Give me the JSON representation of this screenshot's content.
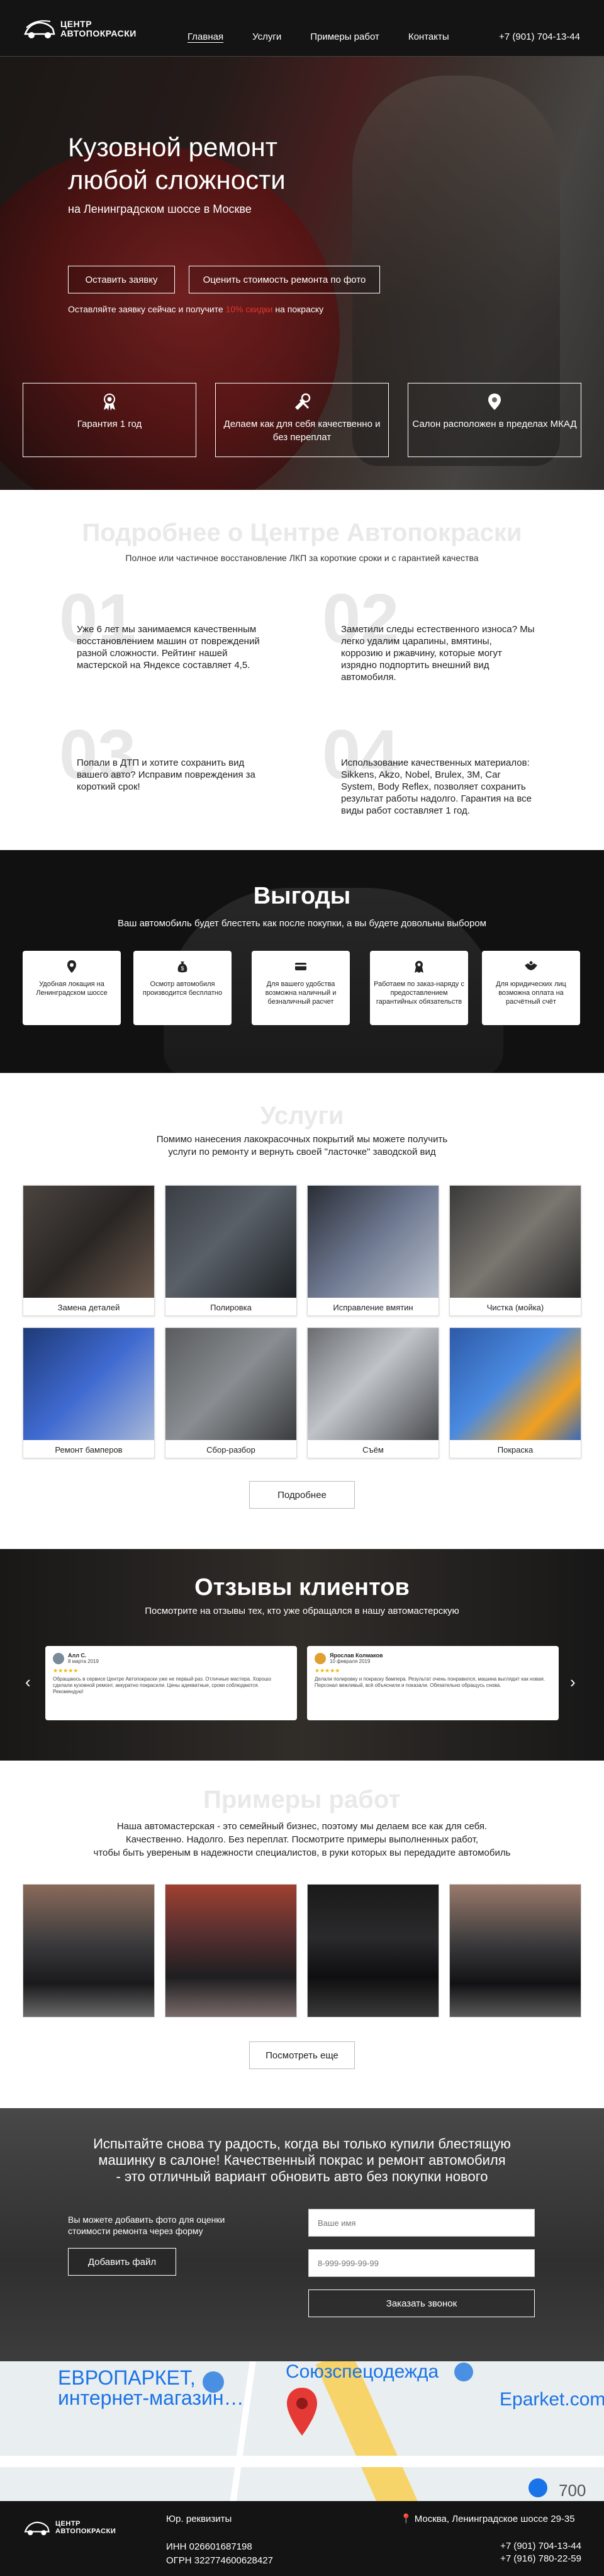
{
  "header": {
    "logo_text_line1": "ЦЕНТР",
    "logo_text_line2": "АВТОПОКРАСКИ",
    "nav": [
      "Главная",
      "Услуги",
      "Примеры работ",
      "Контакты"
    ],
    "phone": "+7 (901) 704-13-44"
  },
  "hero": {
    "title": "Кузовной ремонт любой сложности",
    "subtitle": "на Ленинградском шоссе в Москве",
    "btn_request": "Оставить заявку",
    "btn_estimate": "Оценить стоимость ремонта по фото",
    "note_prefix": "Оставляйте заявку сейчас и получите",
    "note_highlight": "10% скидки",
    "note_suffix": "на покраску",
    "features": [
      {
        "icon": "award-icon",
        "text": "Гарантия 1 год"
      },
      {
        "icon": "tools-icon",
        "text": "Делаем как для себя качественно и без переплат"
      },
      {
        "icon": "location-pin-icon",
        "text": "Салон расположен в пределах МКАД"
      }
    ]
  },
  "about": {
    "title": "Подробнее о Центре Автопокраски",
    "lead": "Полное или частичное восстановление ЛКП за короткие сроки и с гарантией качества",
    "items": [
      {
        "num": "01",
        "text": "Уже 6 лет мы занимаемся качественным восстановлением машин от повреждений разной сложности. Рейтинг нашей мастерской на Яндексе составляет 4,5."
      },
      {
        "num": "02",
        "text": "Заметили следы естественного износа? Мы легко удалим царапины, вмятины, коррозию и ржавчину, которые могут изрядно подпортить внешний вид автомобиля."
      },
      {
        "num": "03",
        "text": "Попали в ДТП и хотите сохранить вид вашего авто? Исправим повреждения за короткий срок!"
      },
      {
        "num": "04",
        "text": "Использование качественных материалов: Sikkens, Akzo, Nobel, Brulex, 3M, Car System, Body Reflex, позволяет сохранить результат работы надолго. Гарантия на все виды работ составляет 1 год."
      }
    ]
  },
  "benefits": {
    "title": "Выгоды",
    "lead": "Ваш автомобиль будет блестеть как после покупки, а вы будете довольны выбором",
    "cards": [
      {
        "icon": "location-pin-icon",
        "text": "Удобная локация на Ленинградском шоссе"
      },
      {
        "icon": "money-bag-icon",
        "text": "Осмотр автомобиля производится бесплатно"
      },
      {
        "icon": "card-icon",
        "text": "Для вашего удобства возможна наличный и безналичный расчет"
      },
      {
        "icon": "award-icon",
        "text": "Работаем по заказ-наряду с предоставлением гарантийных обязательств"
      },
      {
        "icon": "handshake-icon",
        "text": "Для юридических лиц возможна оплата на расчётный счёт"
      }
    ]
  },
  "services": {
    "title": "Услуги",
    "lead_line1": "Помимо нанесения лакокрасочных покрытий мы можете получить",
    "lead_line2": "услуги по ремонту и вернуть своей \"ласточке\" заводской вид",
    "items": [
      "Замена деталей",
      "Полировка",
      "Исправление вмятин",
      "Чистка (мойка)",
      "Ремонт бамперов",
      "Сбор-разбор",
      "Съём",
      "Покраска"
    ],
    "more_label": "Подробнее"
  },
  "reviews": {
    "title": "Отзывы клиентов",
    "lead": "Посмотрите на отзывы тех, кто уже обращался в нашу автомастерскую",
    "items": [
      {
        "name": "Алл С.",
        "date": "8 марта 2019",
        "text": "Обращаюсь в сервисе Центре Автопокраски уже не первый раз. Отличные мастера. Хорошо сделали кузовной ремонт, аккуратно покрасили. Цены адекватные, сроки соблюдаются. Рекомендую!"
      },
      {
        "name": "Ярослав Колмаков",
        "date": "10 февраля 2019",
        "text": "Делали полировку и покраску бампера. Результат очень понравился, машина выглядит как новая. Персонал вежливый, всё объяснили и показали. Обязательно обращусь снова."
      }
    ]
  },
  "works": {
    "title": "Примеры работ",
    "lead_line1": "Наша автомастерская - это семейный бизнес, поэтому мы делаем все как для себя.",
    "lead_line2": "Качественно. Надолго. Без переплат. Посмотрите примеры выполненных работ,",
    "lead_line3": "чтобы быть увереным в надежности специалистов, в руки которых вы передадите автомобиль",
    "more_label": "Посмотреть еще"
  },
  "cta": {
    "title_line1": "Испытайте снова ту радость, когда вы только купили блестящую",
    "title_line2": "машинку в салоне! Качественный покрас и ремонт автомобиля",
    "title_line3": "- это отличный вариант обновить авто без покупки нового",
    "left_text": "Вы можете добавить фото для оценки стоимости ремонта через форму",
    "file_label": "Добавить файл",
    "name_placeholder": "Ваше имя",
    "phone_placeholder": "8-999-999-99-99",
    "call_label": "Заказать звонок"
  },
  "map": {
    "label1_line1": "ЕВРОПАРКЕТ,",
    "label1_line2": "интернет-магазин…",
    "label2": "Союзспецодежда",
    "label3": "Eparket.com",
    "label4": "700"
  },
  "footer": {
    "requisites": "Юр. реквизиты",
    "inn": "ИНН 026601687198",
    "ogrn": "ОГРН 322774600628427",
    "address": "Москва, Ленинградское шоссе 29-35",
    "phone1": "+7 (901) 704-13-44",
    "phone2": "+7 (916) 780-22-59"
  }
}
